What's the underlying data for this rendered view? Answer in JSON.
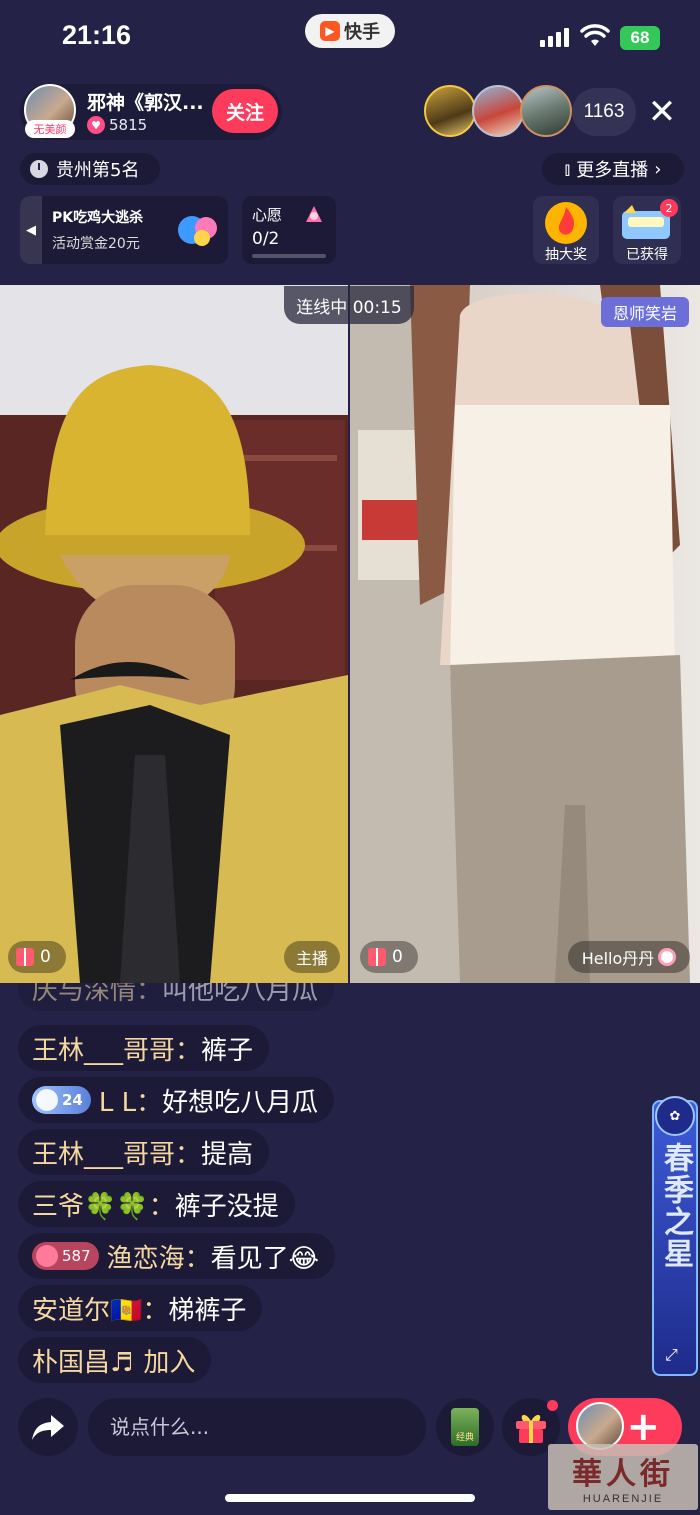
{
  "status_bar": {
    "time": "21:16",
    "app_name": "快手",
    "battery": "68"
  },
  "host": {
    "name": "邪神《郭汉...",
    "tag": "无美颜",
    "likes": "5815",
    "follow_label": "关注"
  },
  "viewers": {
    "count": "1163"
  },
  "rank": {
    "label": "贵州第5名"
  },
  "more_live": {
    "label": "更多直播"
  },
  "pk_event": {
    "title": "PK吃鸡大逃杀",
    "subtitle": "活动赏金20元"
  },
  "wish": {
    "title": "心愿",
    "progress_text": "0/2"
  },
  "lottery": {
    "label": "抽大奖"
  },
  "obtained": {
    "label": "已获得",
    "badge": "2"
  },
  "video": {
    "connection_status": "连线中 00:15",
    "partner_tag": "恩师笑岩",
    "left_gift_count": "0",
    "right_gift_count": "0",
    "host_label": "主播",
    "partner_label": "Hello丹丹"
  },
  "chat": {
    "messages": [
      {
        "name": "庆与深情：",
        "text": "叫他吃八月瓜"
      },
      {
        "name": "王林___哥哥：",
        "text": "裤子"
      },
      {
        "badge": "24",
        "name": "L L：",
        "text": "好想吃八月瓜"
      },
      {
        "name": "王林___哥哥：",
        "text": "提高"
      },
      {
        "name": "三爷🍀🍀：",
        "text": "裤子没提"
      },
      {
        "badge": "587",
        "name": "渔恋海：",
        "text": "看见了😂"
      },
      {
        "name": "安道尔🇦🇩：",
        "text": "梯裤子"
      },
      {
        "name": "朴国昌♬",
        "text": "加入"
      }
    ]
  },
  "side_banner": {
    "text": "春季之星"
  },
  "bottom_bar": {
    "comment_placeholder": "说点什么...",
    "book_label": "经典"
  },
  "watermark": {
    "cn": "華人街",
    "en": "HUARENJIE"
  },
  "colors": {
    "background": "#242247",
    "accent": "#ff3b5c",
    "banner": "#3d5bd9"
  }
}
